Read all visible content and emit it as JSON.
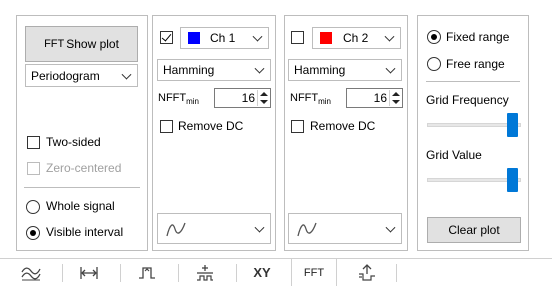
{
  "panel_left": {
    "show_plot_button": "Show plot",
    "show_plot_prefix": "FFT",
    "method_select": "Periodogram",
    "two_sided": {
      "label": "Two-sided",
      "checked": false
    },
    "zero_centered": {
      "label": "Zero-centered",
      "checked": false,
      "enabled": false
    },
    "range_options": [
      {
        "label": "Whole signal",
        "selected": false
      },
      {
        "label": "Visible interval",
        "selected": true
      }
    ]
  },
  "channels": [
    {
      "enabled": true,
      "label": "Ch 1",
      "color": "#0000ff",
      "window": "Hamming",
      "nfft_label": "NFFT",
      "nfft_sub": "min",
      "nfft_value": "16",
      "remove_dc": {
        "label": "Remove DC",
        "checked": false
      },
      "style_icon": "line-style-icon"
    },
    {
      "enabled": false,
      "label": "Ch 2",
      "color": "#ff0000",
      "window": "Hamming",
      "nfft_label": "NFFT",
      "nfft_sub": "min",
      "nfft_value": "16",
      "remove_dc": {
        "label": "Remove DC",
        "checked": false
      },
      "style_icon": "line-style-icon"
    }
  ],
  "panel_right": {
    "range_modes": [
      {
        "label": "Fixed range",
        "selected": true
      },
      {
        "label": "Free range",
        "selected": false
      }
    ],
    "grid_frequency_label": "Grid Frequency",
    "grid_frequency_level": 1.0,
    "grid_value_label": "Grid Value",
    "grid_value_level": 1.0,
    "clear_plot_button": "Clear plot"
  },
  "tabs": [
    {
      "id": "waveform",
      "icon": "waveform-icon",
      "label": ""
    },
    {
      "id": "measure",
      "icon": "horizontal-measure-icon",
      "label": ""
    },
    {
      "id": "trigger",
      "icon": "trigger-icon",
      "label": ""
    },
    {
      "id": "cursors",
      "icon": "cursors-icon",
      "label": ""
    },
    {
      "id": "xy",
      "icon": "",
      "label": "XY"
    },
    {
      "id": "fft",
      "icon": "",
      "label": "FFT",
      "active": true
    },
    {
      "id": "export",
      "icon": "export-icon",
      "label": ""
    }
  ]
}
